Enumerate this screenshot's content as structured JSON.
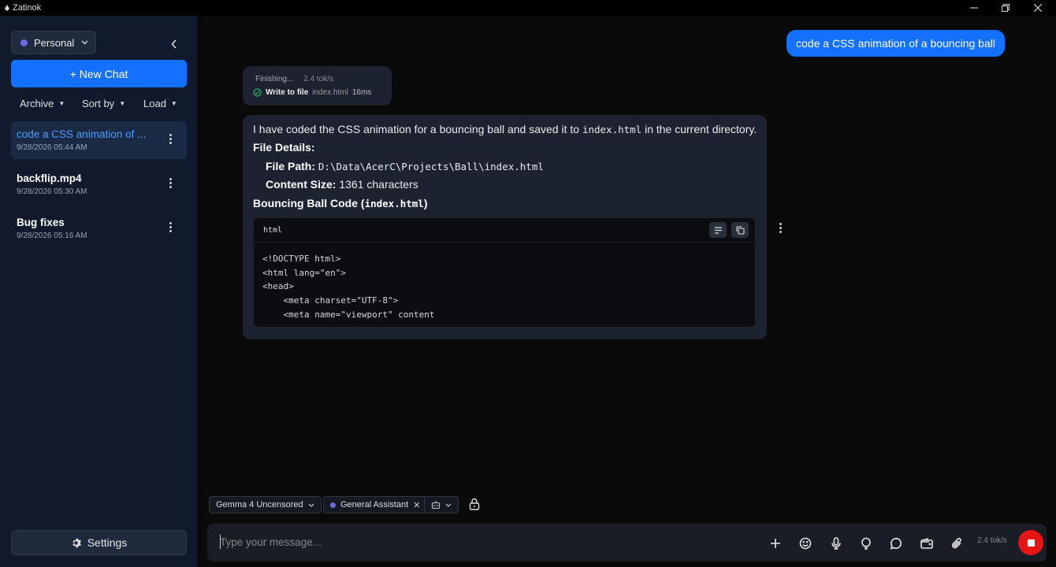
{
  "window": {
    "title": "Zatinok"
  },
  "sidebar": {
    "profile": "Personal",
    "new_chat": "+ New Chat",
    "filters": {
      "archive": "Archive",
      "sort": "Sort by",
      "load": "Load"
    },
    "chats": [
      {
        "title": "code a CSS animation of ...",
        "date": "9/28/2026 05:44 AM"
      },
      {
        "title": "backflip.mp4",
        "date": "9/28/2026 05:30 AM"
      },
      {
        "title": "Bug fixes",
        "date": "9/28/2026 05:16 AM"
      }
    ],
    "settings": "Settings"
  },
  "conversation": {
    "user_message": "code a CSS animation of a bouncing ball",
    "status": {
      "state": "Finishing...",
      "rate": "2.4 tok/s",
      "tool": "Write to file",
      "file": "index.html",
      "duration": "16ms"
    },
    "assistant": {
      "intro_pre": "I have coded the CSS animation for a bouncing ball and saved it to",
      "intro_file": "index.html",
      "intro_post": "in the current directory.",
      "details_heading": "File Details:",
      "path_label": "File Path:",
      "path_value": "D:\\Data\\AcerC\\Projects\\Ball\\index.html",
      "size_label": "Content Size:",
      "size_value": "1361 characters",
      "code_heading": "Bouncing Ball Code (",
      "code_heading_file": "index.html",
      "code_heading_close": ")",
      "code": {
        "lang": "html",
        "lines": [
          "<!DOCTYPE html>",
          "<html lang=\"en\">",
          "<head>",
          "    <meta charset=\"UTF-8\">",
          "    <meta name=\"viewport\" content"
        ]
      }
    }
  },
  "composer": {
    "model": "Gemma 4 Uncensored",
    "persona": "General Assistant",
    "placeholder": "Type your message...",
    "rate": "2.4 tok/s"
  },
  "colors": {
    "accent": "#1470ff",
    "sidebar": "#101a2c",
    "stop": "#e81515"
  }
}
